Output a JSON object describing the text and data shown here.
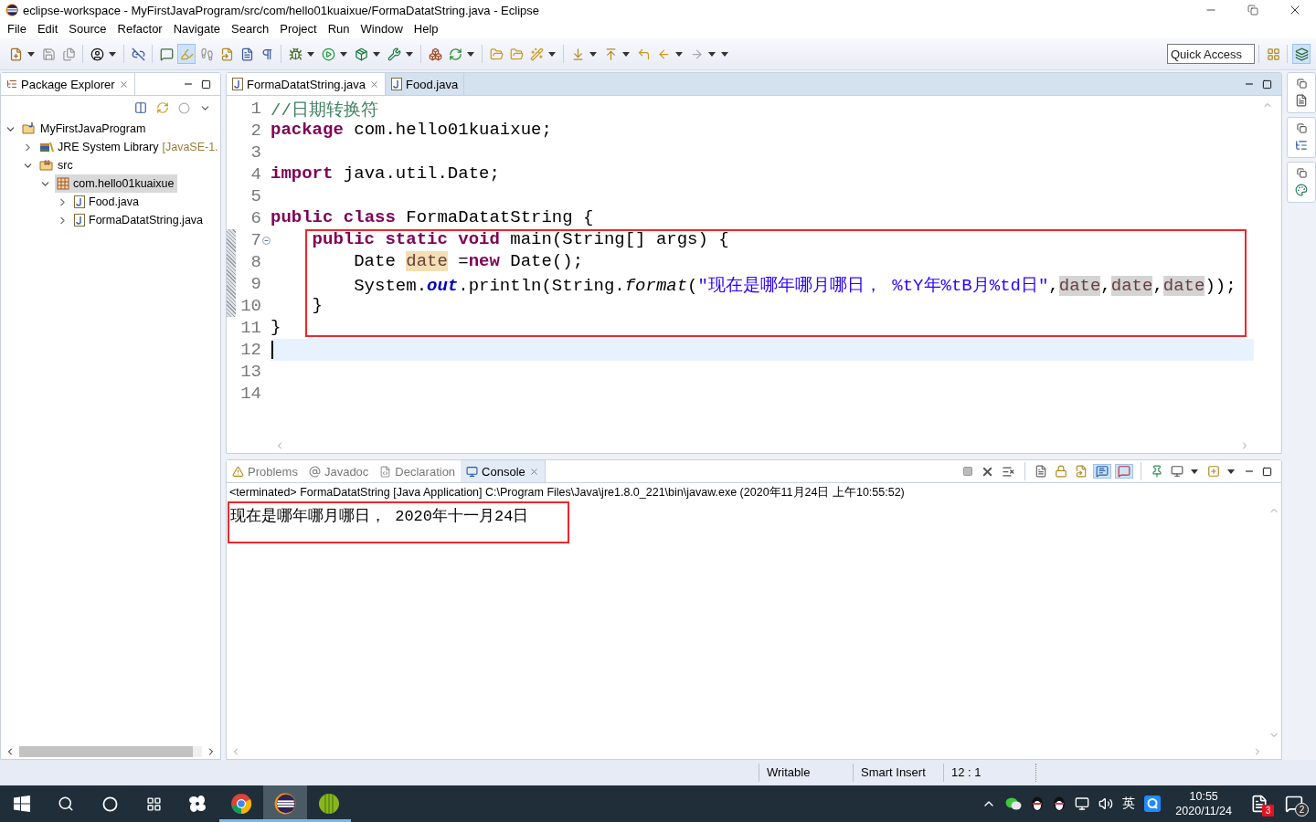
{
  "window": {
    "title": "eclipse-workspace - MyFirstJavaProgram/src/com/hello01kuaixue/FormaDatatString.java - Eclipse"
  },
  "menu": [
    "File",
    "Edit",
    "Source",
    "Refactor",
    "Navigate",
    "Search",
    "Project",
    "Run",
    "Window",
    "Help"
  ],
  "quick_access": {
    "placeholder": "Quick Access"
  },
  "package_explorer": {
    "title": "Package Explorer",
    "tree": [
      {
        "label": "MyFirstJavaProgram",
        "kind": "project",
        "expanded": true,
        "selected": false,
        "children": [
          {
            "label": "JRE System Library",
            "decoration": "[JavaSE-1.",
            "kind": "library",
            "expanded": false,
            "selected": false
          },
          {
            "label": "src",
            "kind": "folder",
            "expanded": true,
            "selected": false,
            "children": [
              {
                "label": "com.hello01kuaixue",
                "kind": "package",
                "expanded": true,
                "selected": true,
                "children": [
                  {
                    "label": "Food.java",
                    "kind": "file",
                    "expanded": false,
                    "selected": false
                  },
                  {
                    "label": "FormaDatatString.java",
                    "kind": "file",
                    "expanded": false,
                    "selected": false
                  }
                ]
              }
            ]
          }
        ]
      }
    ]
  },
  "editor": {
    "tabs": [
      {
        "label": "FormaDatatString.java",
        "selected": true
      },
      {
        "label": "Food.java",
        "selected": false
      }
    ],
    "highlight_box": true,
    "lines": [
      {
        "number": "1",
        "fold": false,
        "current": false,
        "tokens": [
          {
            "kind": "comment",
            "text": "//日期转换符"
          }
        ]
      },
      {
        "number": "2",
        "fold": false,
        "current": false,
        "tokens": [
          {
            "kind": "kw",
            "text": "package"
          },
          {
            "kind": "text",
            "text": " com.hello01kuaixue;"
          }
        ]
      },
      {
        "number": "3",
        "fold": false,
        "current": false
      },
      {
        "number": "4",
        "fold": false,
        "current": false,
        "tokens": [
          {
            "kind": "kw",
            "text": "import"
          },
          {
            "kind": "text",
            "text": " java.util.Date;"
          }
        ]
      },
      {
        "number": "5",
        "fold": false,
        "current": false
      },
      {
        "number": "6",
        "fold": false,
        "current": false,
        "tokens": [
          {
            "kind": "kw",
            "text": "public"
          },
          {
            "kind": "kw",
            "text": " class"
          },
          {
            "kind": "text",
            "text": " FormaDatatString {"
          }
        ]
      },
      {
        "number": "7",
        "fold": true,
        "current": false,
        "tokens": [
          {
            "kind": "kw",
            "text": "    public"
          },
          {
            "kind": "kw",
            "text": " static"
          },
          {
            "kind": "kw",
            "text": " void"
          },
          {
            "kind": "text",
            "text": " main(String[] args) {"
          }
        ]
      },
      {
        "number": "8",
        "fold": false,
        "current": false,
        "tokens": [
          {
            "kind": "text",
            "text": "        Date "
          },
          {
            "kind": "occurrence_write",
            "text": "date"
          },
          {
            "kind": "text",
            "text": " ="
          },
          {
            "kind": "kw",
            "text": "new"
          },
          {
            "kind": "text",
            "text": " Date();"
          }
        ]
      },
      {
        "number": "9",
        "fold": false,
        "current": false,
        "tokens": [
          {
            "kind": "text",
            "text": "        System."
          },
          {
            "kind": "field",
            "text": "out"
          },
          {
            "kind": "text",
            "text": ".println(String."
          },
          {
            "kind": "method",
            "text": "format"
          },
          {
            "kind": "text",
            "text": "("
          },
          {
            "kind": "string",
            "text": "\"现在是哪年哪月哪日， %tY年%tB月%td日\""
          },
          {
            "kind": "text",
            "text": ","
          },
          {
            "kind": "occurrence",
            "text": "date"
          },
          {
            "kind": "text",
            "text": ","
          },
          {
            "kind": "occurrence",
            "text": "date"
          },
          {
            "kind": "text",
            "text": ","
          },
          {
            "kind": "occurrence",
            "text": "date"
          },
          {
            "kind": "text",
            "text": "));"
          }
        ]
      },
      {
        "number": "10",
        "fold": false,
        "current": false,
        "tokens": [
          {
            "kind": "text",
            "text": "    }"
          }
        ]
      },
      {
        "number": "11",
        "fold": false,
        "current": false,
        "tokens": [
          {
            "kind": "text",
            "text": "}"
          }
        ]
      },
      {
        "number": "12",
        "fold": false,
        "current": true
      },
      {
        "number": "13",
        "fold": false,
        "current": false
      },
      {
        "number": "14",
        "fold": false,
        "current": false
      }
    ]
  },
  "console": {
    "tabs": [
      {
        "label": "Problems",
        "kind": "problems",
        "selected": false
      },
      {
        "label": "Javadoc",
        "kind": "javadoc",
        "selected": false
      },
      {
        "label": "Declaration",
        "kind": "declaration",
        "selected": false
      },
      {
        "label": "Console",
        "kind": "console",
        "selected": true
      }
    ],
    "header": "<terminated> FormaDatatString [Java Application] C:\\Program Files\\Java\\jre1.8.0_221\\bin\\javaw.exe (2020年11月24日 上午10:55:52)",
    "output": "现在是哪年哪月哪日， 2020年十一月24日",
    "highlight_box": true
  },
  "status_bar": [
    "Writable",
    "Smart Insert",
    "12 : 1"
  ],
  "taskbar": {
    "apps": [
      {
        "kind": "pinwheel",
        "running": false,
        "selected": false
      },
      {
        "kind": "chrome",
        "running": true,
        "selected": false
      },
      {
        "kind": "eclipse",
        "running": true,
        "selected": true
      },
      {
        "kind": "melon",
        "running": true,
        "selected": false
      }
    ],
    "ime": "英",
    "time": "10:55",
    "date": "2020/11/24",
    "notification_count": "3",
    "message_count": "2"
  }
}
